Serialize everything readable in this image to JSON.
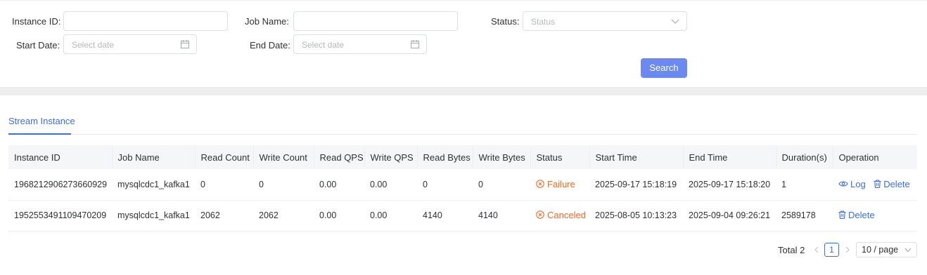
{
  "filters": {
    "instance_id_label": "Instance ID",
    "job_name_label": "Job Name",
    "status_label": "Status",
    "status_placeholder": "Status",
    "start_date_label": "Start Date",
    "start_date_placeholder": "Select date",
    "end_date_label": "End Date",
    "end_date_placeholder": "Select date",
    "search_label": "Search"
  },
  "tabs": [
    {
      "label": "Stream Instance",
      "active": true
    }
  ],
  "table": {
    "columns": [
      "Instance ID",
      "Job Name",
      "Read Count",
      "Write Count",
      "Read QPS",
      "Write QPS",
      "Read Bytes",
      "Write Bytes",
      "Status",
      "Start Time",
      "End Time",
      "Duration(s)",
      "Operation"
    ],
    "rows": [
      {
        "instance_id": "1968212906273660929",
        "job_name": "mysqlcdc1_kafka1",
        "read_count": "0",
        "write_count": "0",
        "read_qps": "0.00",
        "write_qps": "0.00",
        "read_bytes": "0",
        "write_bytes": "0",
        "status": "Failure",
        "start_time": "2025-09-17 15:18:19",
        "end_time": "2025-09-17 15:18:20",
        "duration": "1",
        "ops": {
          "log": "Log",
          "delete": "Delete"
        }
      },
      {
        "instance_id": "1952553491109470209",
        "job_name": "mysqlcdc1_kafka1",
        "read_count": "2062",
        "write_count": "2062",
        "read_qps": "0.00",
        "write_qps": "0.00",
        "read_bytes": "4140",
        "write_bytes": "4140",
        "status": "Canceled",
        "start_time": "2025-08-05 10:13:23",
        "end_time": "2025-09-04 09:26:21",
        "duration": "2589178",
        "ops": {
          "delete": "Delete"
        }
      }
    ]
  },
  "pagination": {
    "total": "Total 2",
    "current_page": "1",
    "page_size": "10 / page"
  },
  "colors": {
    "primary": "#3b6fe0",
    "search_button": "#6b89f0",
    "status_error": "#f5692a"
  },
  "icons": {
    "date": "calendar-icon",
    "select": "chevron-down-icon",
    "status": "circle-x-icon",
    "log": "eye-icon",
    "delete": "trash-icon"
  }
}
